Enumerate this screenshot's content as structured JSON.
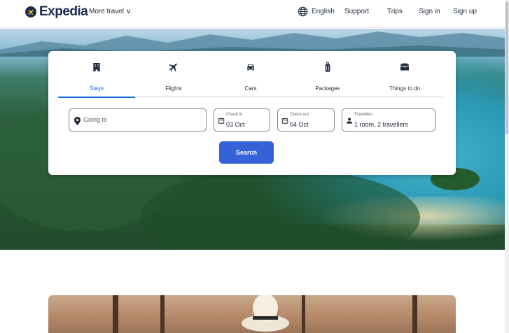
{
  "header": {
    "brand": "Expedia",
    "more_travel": "More travel ∨",
    "language": "English",
    "support": "Support",
    "trips": "Trips",
    "sign_in": "Sign in",
    "sign_up": "Sign up"
  },
  "search": {
    "tabs": [
      {
        "label": "Stays",
        "icon": "hotel-icon",
        "active": true
      },
      {
        "label": "Flights",
        "icon": "plane-icon",
        "active": false
      },
      {
        "label": "Cars",
        "icon": "car-icon",
        "active": false
      },
      {
        "label": "Packages",
        "icon": "luggage-icon",
        "active": false
      },
      {
        "label": "Things to do",
        "icon": "ticket-icon",
        "active": false
      }
    ],
    "destination": {
      "placeholder": "Going to"
    },
    "check_in": {
      "label": "Check in",
      "value": "03 Oct"
    },
    "check_out": {
      "label": "Check out",
      "value": "04 Oct"
    },
    "travellers": {
      "label": "Travellers",
      "value": "1 room, 2 travellers"
    },
    "button": "Search"
  },
  "colors": {
    "accent": "#1668e3",
    "button": "#3662d8",
    "brand": "#1b2b4f"
  }
}
